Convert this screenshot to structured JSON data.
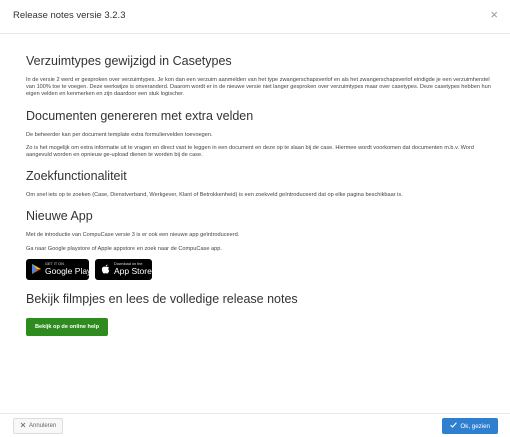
{
  "dialog": {
    "title": "Release notes versie 3.2.3",
    "close_glyph": "×"
  },
  "sections": [
    {
      "heading": "Verzuimtypes gewijzigd in Casetypes",
      "paragraphs": [
        "In de versie 2 werd er gesproken over verzuimtypes. Je kon dan een verzuim aanmelden van het type zwangerschapsverlof en als het zwangerschapsverlof eindigde je een verzuimherstel van 100% toe te voegen. Deze werkwijze is onveranderd. Daarom wordt er in de nieuwe versie niet langer gesproken over verzuimtypes maar over casetypes. Deze casetypes hebben hun eigen velden en kenmerken en zijn daardoor een stuk logischer."
      ]
    },
    {
      "heading": "Documenten genereren met extra velden",
      "paragraphs": [
        "De beheerder kan per document template extra formuliervelden toevoegen.",
        "Zo is het mogelijk om extra informatie uit te vragen en direct vast te leggen in een document en deze op te slaan bij de case. Hiermee wordt voorkomen dat documenten m.b.v. Word aangevuld worden en opnieuw ge-upload dienen te worden bij de case."
      ]
    },
    {
      "heading": "Zoekfunctionaliteit",
      "paragraphs": [
        "Om snel iets op te zoeken (Case, Dienstverband, Werkgever, Klant of Betrokkenheid) is een zoekveld geïntroduceerd dat op elke pagina beschikbaar is."
      ]
    },
    {
      "heading": "Nieuwe App",
      "paragraphs": [
        "Met de introductie van CompuCase versie 3 is er ook een nieuwe app geïntroduceerd.",
        "Ga naar Google playstore of Apple appstore en zoek naar de CompuCase app."
      ]
    }
  ],
  "stores": {
    "google_small": "GET IT ON",
    "google_big": "Google Play",
    "apple_small": "Download on the",
    "apple_big": "App Store"
  },
  "help": {
    "heading": "Bekijk filmpjes en lees de volledige release notes",
    "button_label": "Bekijk op de online help"
  },
  "footer": {
    "cancel_label": "Annuleren",
    "ok_label": "Ok, gezien"
  },
  "colors": {
    "help_button": "#2e8b1e",
    "ok_button": "#2f7fd0"
  }
}
